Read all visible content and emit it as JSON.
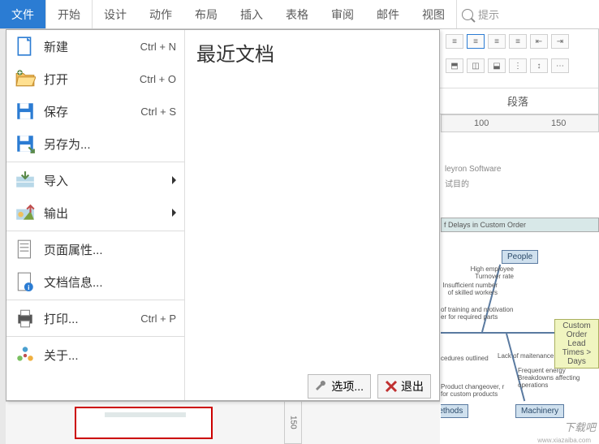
{
  "menubar": {
    "tabs": [
      "文件",
      "开始",
      "设计",
      "动作",
      "布局",
      "插入",
      "表格",
      "审阅",
      "邮件",
      "视图"
    ],
    "search_placeholder": "提示"
  },
  "file_menu": {
    "items": [
      {
        "label": "新建",
        "shortcut": "Ctrl + N",
        "icon": "new"
      },
      {
        "label": "打开",
        "shortcut": "Ctrl + O",
        "icon": "open"
      },
      {
        "label": "保存",
        "shortcut": "Ctrl + S",
        "icon": "save"
      },
      {
        "label": "另存为...",
        "shortcut": "",
        "icon": "saveas"
      },
      {
        "label": "导入",
        "shortcut": "",
        "icon": "import",
        "arrow": true
      },
      {
        "label": "输出",
        "shortcut": "",
        "icon": "export",
        "arrow": true
      },
      {
        "label": "页面属性...",
        "shortcut": "",
        "icon": "page"
      },
      {
        "label": "文档信息...",
        "shortcut": "",
        "icon": "info"
      },
      {
        "label": "打印...",
        "shortcut": "Ctrl + P",
        "icon": "print"
      },
      {
        "label": "关于...",
        "shortcut": "",
        "icon": "about"
      }
    ],
    "recent_title": "最近文档",
    "options_btn": "选项...",
    "exit_btn": "退出"
  },
  "paragraph": {
    "label": "段落"
  },
  "ruler": {
    "marks": [
      "100",
      "150"
    ]
  },
  "canvas": {
    "software_text": "leyron Software",
    "purpose_text": "试目的",
    "diagram_title": "f Delays in Custom Order",
    "nodes": {
      "people": "People",
      "methods": "Methods",
      "machinery": "Machinery",
      "outcome": "Custom Order Lead Times > Days"
    },
    "annotations": {
      "a1": "High employee Turnover rate",
      "a2": "Insufficient number of skilled workers",
      "a3": "of training and motivation er for required parts",
      "a4": "cedures outlined",
      "a5": "Lack of maitenance",
      "a6": "Frequent energy Breakdowns affecting operations",
      "a7": "Product changeover, r for custom products"
    }
  },
  "vruler": {
    "mark": "150"
  },
  "watermark": "下载吧",
  "watermark_url": "www.xiazaiba.com"
}
